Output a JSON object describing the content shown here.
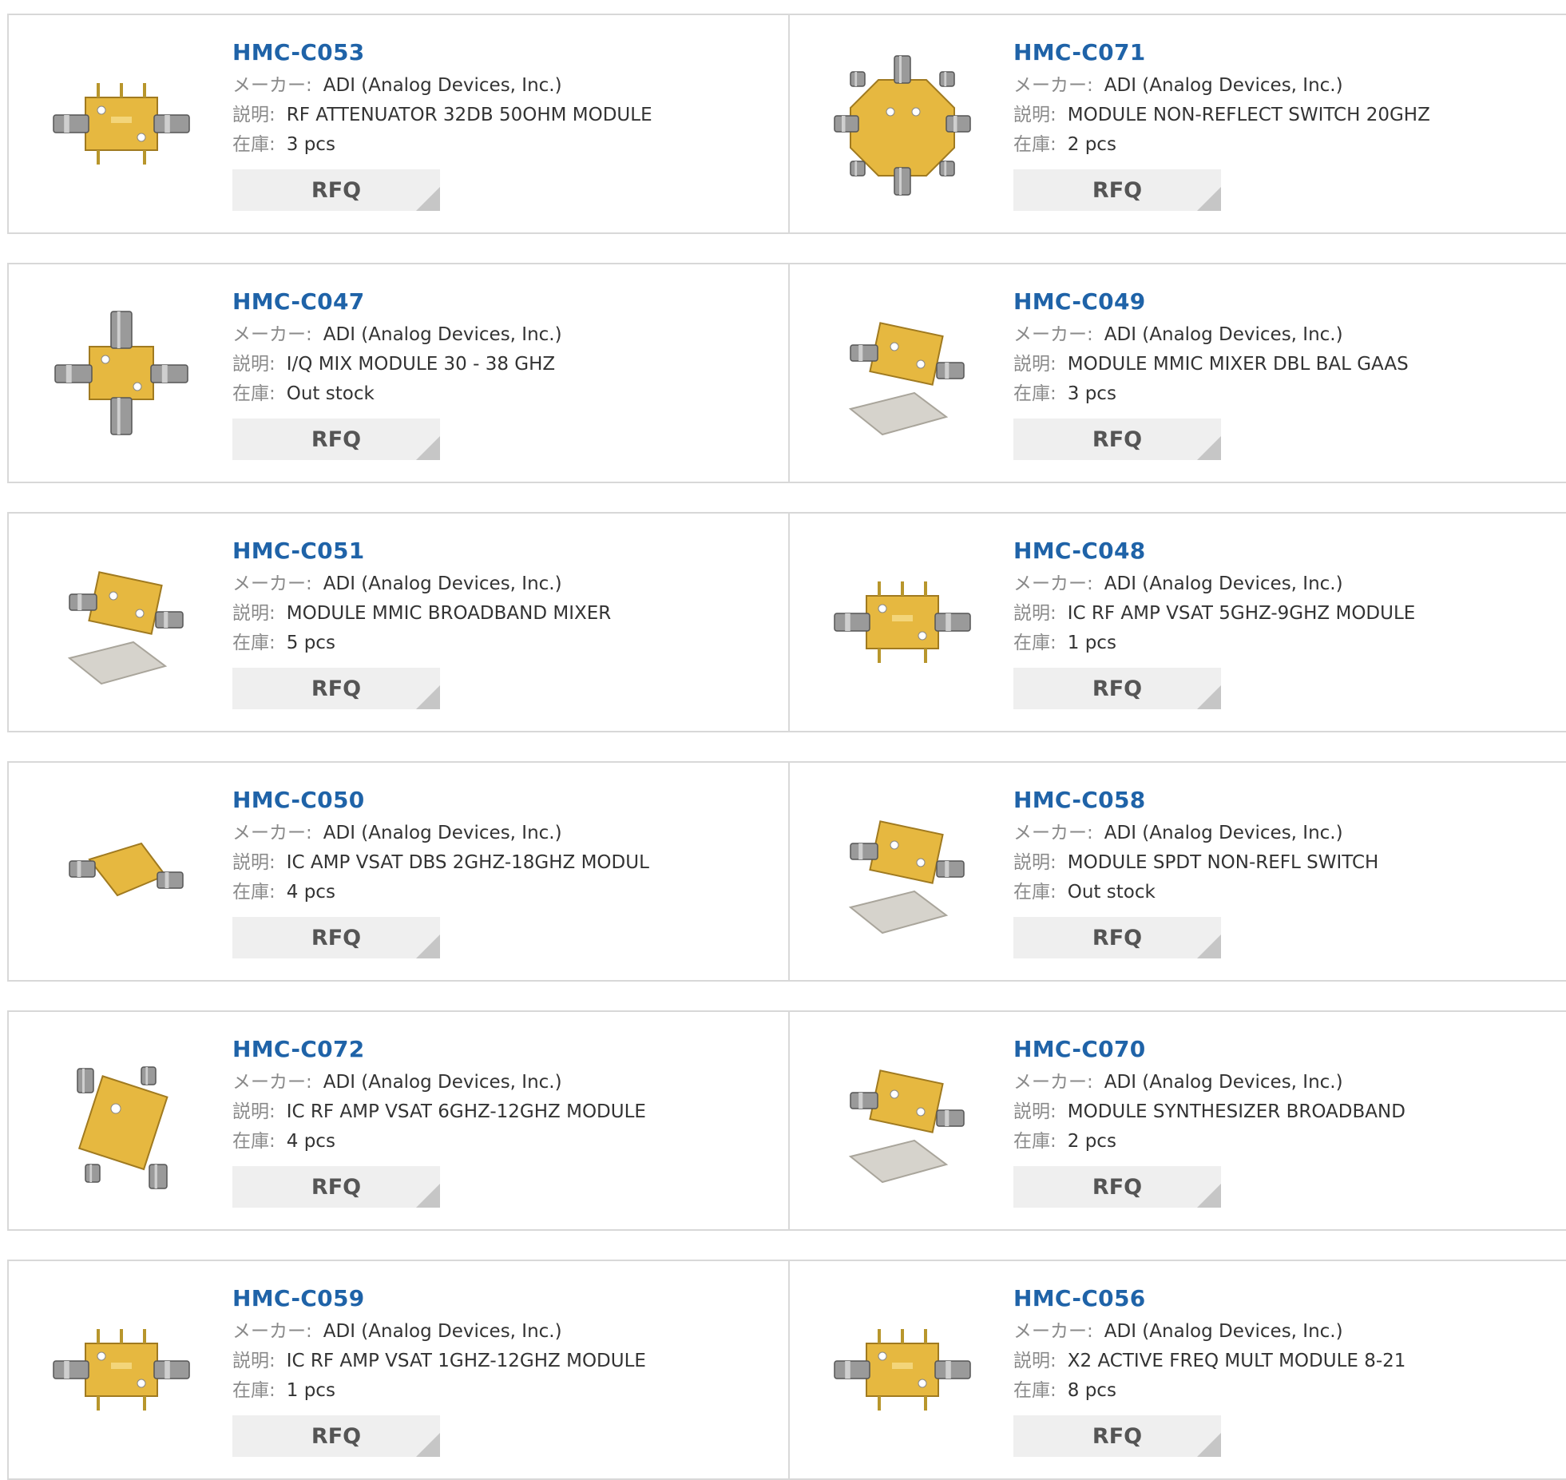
{
  "labels": {
    "maker": "メーカー:",
    "desc": "説明:",
    "stock": "在庫:",
    "rfq": "RFQ"
  },
  "colors": {
    "link": "#1f63a8",
    "button_bg": "#efefef",
    "button_corner": "#c6c6c6",
    "border": "#d8d8d8",
    "gold": "#e6b840"
  },
  "products": [
    {
      "pn": "HMC-C053",
      "maker": "ADI (Analog Devices, Inc.)",
      "desc": "RF ATTENUATOR 32DB 50OHM MODULE",
      "stock": "3 pcs",
      "image": "gold-module-2port"
    },
    {
      "pn": "HMC-C071",
      "maker": "ADI (Analog Devices, Inc.)",
      "desc": "MODULE NON-REFLECT SWITCH 20GHZ",
      "stock": "2 pcs",
      "image": "gold-octagon-switch"
    },
    {
      "pn": "HMC-C047",
      "maker": "ADI (Analog Devices, Inc.)",
      "desc": "I/Q MIX MODULE 30 - 38 GHZ",
      "stock": "Out stock",
      "image": "gold-module-4port"
    },
    {
      "pn": "HMC-C049",
      "maker": "ADI (Analog Devices, Inc.)",
      "desc": "MODULE MMIC MIXER DBL BAL GAAS",
      "stock": "3 pcs",
      "image": "gold-module-with-cover"
    },
    {
      "pn": "HMC-C051",
      "maker": "ADI (Analog Devices, Inc.)",
      "desc": "MODULE MMIC BROADBAND MIXER",
      "stock": "5 pcs",
      "image": "gold-module-with-cover"
    },
    {
      "pn": "HMC-C048",
      "maker": "ADI (Analog Devices, Inc.)",
      "desc": "IC RF AMP VSAT 5GHZ-9GHZ MODULE",
      "stock": "1 pcs",
      "image": "gold-module-2port"
    },
    {
      "pn": "HMC-C050",
      "maker": "ADI (Analog Devices, Inc.)",
      "desc": "IC AMP VSAT DBS 2GHZ-18GHZ MODUL",
      "stock": "4 pcs",
      "image": "gold-module-small"
    },
    {
      "pn": "HMC-C058",
      "maker": "ADI (Analog Devices, Inc.)",
      "desc": "MODULE SPDT NON-REFL SWITCH",
      "stock": "Out stock",
      "image": "gold-module-with-cover"
    },
    {
      "pn": "HMC-C072",
      "maker": "ADI (Analog Devices, Inc.)",
      "desc": "IC RF AMP VSAT 6GHZ-12GHZ MODULE",
      "stock": "4 pcs",
      "image": "gold-module-tilted"
    },
    {
      "pn": "HMC-C070",
      "maker": "ADI (Analog Devices, Inc.)",
      "desc": "MODULE SYNTHESIZER BROADBAND",
      "stock": "2 pcs",
      "image": "gold-module-with-cover"
    },
    {
      "pn": "HMC-C059",
      "maker": "ADI (Analog Devices, Inc.)",
      "desc": "IC RF AMP VSAT 1GHZ-12GHZ MODULE",
      "stock": "1 pcs",
      "image": "gold-module-2port"
    },
    {
      "pn": "HMC-C056",
      "maker": "ADI (Analog Devices, Inc.)",
      "desc": "X2 ACTIVE FREQ MULT MODULE 8-21",
      "stock": "8 pcs",
      "image": "gold-module-2port"
    }
  ]
}
